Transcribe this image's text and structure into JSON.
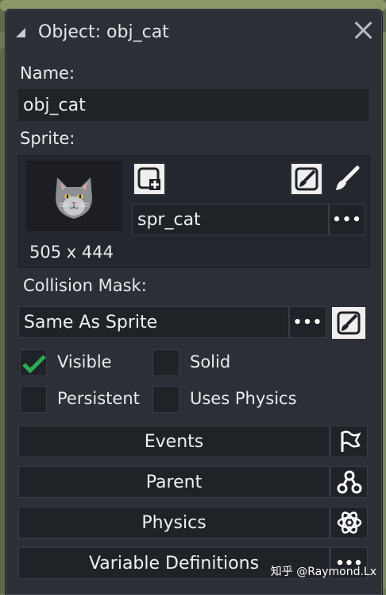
{
  "window": {
    "title": "Object: obj_cat"
  },
  "name": {
    "label": "Name:",
    "value": "obj_cat"
  },
  "sprite": {
    "label": "Sprite:",
    "value": "spr_cat",
    "dimensions": "505 x 444"
  },
  "collision": {
    "label": "Collision Mask:",
    "value": "Same As Sprite"
  },
  "checkboxes": {
    "visible": {
      "label": "Visible",
      "checked": true
    },
    "solid": {
      "label": "Solid",
      "checked": false
    },
    "persistent": {
      "label": "Persistent",
      "checked": false
    },
    "uses_physics": {
      "label": "Uses Physics",
      "checked": false
    }
  },
  "buttons": {
    "events": "Events",
    "parent": "Parent",
    "physics": "Physics",
    "variables": "Variable Definitions"
  },
  "dots": "•••",
  "watermark": "知乎 @Raymond.Lx",
  "colors": {
    "panel": "#2c2f36",
    "field": "#1f2227",
    "check": "#2eaa55",
    "accent_text": "#e9eaed"
  }
}
